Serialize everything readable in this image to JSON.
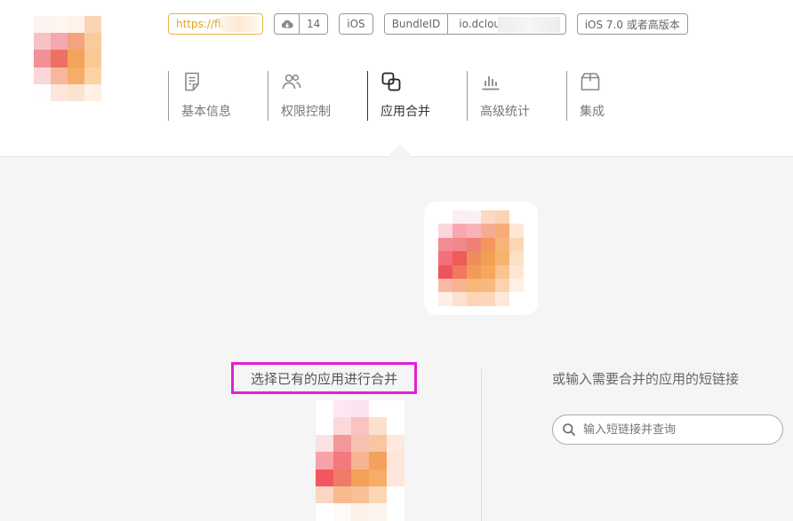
{
  "header": {
    "url_tag": "https://fi.",
    "download_count": "14",
    "platform": "iOS",
    "bundle_id_label": "BundleID",
    "bundle_id_value": "io.dcloud.",
    "min_os": "iOS 7.0 或者高版本"
  },
  "nav": {
    "items": [
      {
        "label": "基本信息",
        "icon": "document-icon"
      },
      {
        "label": "权限控制",
        "icon": "users-icon"
      },
      {
        "label": "应用合并",
        "icon": "merge-icon"
      },
      {
        "label": "高级统计",
        "icon": "bar-chart-icon"
      },
      {
        "label": "集成",
        "icon": "box-icon"
      }
    ],
    "active_index": 2
  },
  "merge": {
    "select_existing": "选择已有的应用进行合并",
    "or_shortlink": "或输入需要合并的应用的短链接",
    "search_placeholder": "输入短链接并查询"
  },
  "colors": {
    "accent_border": "#e01fd6",
    "url_tag": "#e8b64a",
    "active_nav": "#333333",
    "inactive_nav": "#777777"
  },
  "mosaics": {
    "app_logo": [
      "#fdf3f2",
      "#fef4f0",
      "#fff2ea",
      "#fad5b3",
      "#f7c1c6",
      "#f5a8ad",
      "#f5a27e",
      "#facb9a",
      "#f29096",
      "#ef6f64",
      "#f2a55a",
      "#f9c894",
      "#fbd6da",
      "#f7b79b",
      "#f6ad6a",
      "#fcd2a5",
      "#fefefe",
      "#fde7dc",
      "#fbe3d2",
      "#fef0e6"
    ],
    "center_logo": [
      "#ffffff",
      "#fdeef0",
      "#fdf0f2",
      "#fbd9c3",
      "#fad3b4",
      "#ffffff",
      "#fbd7dc",
      "#f7a8b3",
      "#f7b4ba",
      "#f5ab90",
      "#f7ac7a",
      "#fde7d5",
      "#f48b94",
      "#f2878a",
      "#ee8077",
      "#f3955d",
      "#f7b57a",
      "#fad6b4",
      "#f2707a",
      "#ee5b58",
      "#ef8c5e",
      "#f2a152",
      "#f6b36d",
      "#fbdfc6",
      "#ec555b",
      "#f07960",
      "#f49a58",
      "#f5a760",
      "#f9c58d",
      "#fde6d4",
      "#f7b9a6",
      "#f8b28e",
      "#f8b67a",
      "#f7b980",
      "#fbd3b0",
      "#fef0e6",
      "#fdeee6",
      "#fde0cf",
      "#fcd5b7",
      "#fcd8bb",
      "#fde8da",
      "#ffffff"
    ],
    "candidate_app": [
      "#ffffff",
      "#fde7f4",
      "#fbe3f1",
      "#ffffff",
      "#ffffff",
      "#ffffff",
      "#fbd9d8",
      "#f8c3c2",
      "#fbe0cc",
      "#ffffff",
      "#fbe1e1",
      "#f49799",
      "#f7c0b0",
      "#f8c6a3",
      "#fde9de",
      "#f7a2a8",
      "#f2797c",
      "#f7b495",
      "#f3a15c",
      "#fce6da",
      "#f2565e",
      "#f07a69",
      "#f4a058",
      "#f6ad66",
      "#fce7dc",
      "#fad6c3",
      "#f8bb8e",
      "#f8c097",
      "#fbd6b6",
      "#ffffff",
      "#ffffff",
      "#fefaf6",
      "#fdf1e8",
      "#fdf4ee",
      "#ffffff"
    ]
  }
}
